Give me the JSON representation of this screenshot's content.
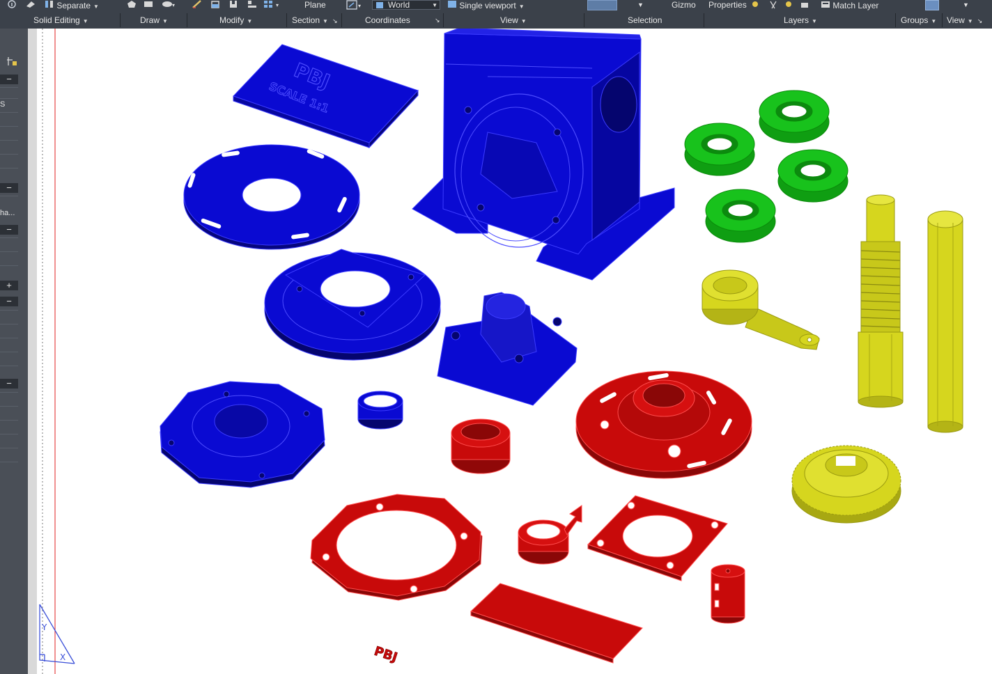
{
  "ribbon": {
    "top_row": {
      "separate": "Separate",
      "plane": "Plane",
      "world": "World",
      "single_viewport": "Single viewport",
      "gizmo": "Gizmo",
      "properties": "Properties",
      "match_layer": "Match Layer"
    },
    "panels": {
      "solid_editing": "Solid Editing",
      "draw": "Draw",
      "modify": "Modify",
      "section": "Section",
      "coordinates": "Coordinates",
      "view": "View",
      "selection": "Selection",
      "layers": "Layers",
      "groups": "Groups",
      "view2": "View"
    }
  },
  "left_palette": {
    "letter_s": "S",
    "truncated_label": "ha..."
  },
  "viewport": {
    "nameplate_title": "PBJ",
    "nameplate_scale": "SCALE 1:1",
    "logo_text": "PBJ",
    "ucs_y": "Y",
    "ucs_x": "X"
  },
  "colors": {
    "blue": "#0a0ad2",
    "red": "#c80a0a",
    "green": "#18c21c",
    "yellow": "#d6d61e",
    "ribbon_bg": "#3b414a",
    "ucs_icon": "#3a4fd8"
  }
}
